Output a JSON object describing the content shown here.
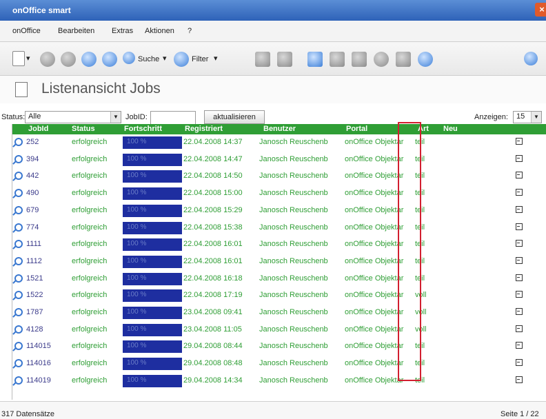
{
  "window": {
    "title": "onOffice smart",
    "close_label": "×"
  },
  "menu": [
    "onOffice",
    "Bearbeiten",
    "Extras",
    "Aktionen",
    "?"
  ],
  "toolbar": {
    "search_label": "Suche",
    "filter_label": "Filter",
    "dropdown_arrow": "▾"
  },
  "page_title": "Listenansicht Jobs",
  "filters": {
    "status_label": "Status:",
    "status_value": "Alle",
    "jobid_label": "JobID:",
    "jobid_value": "",
    "refresh_button": "aktualisieren",
    "show_label": "Anzeigen:",
    "show_value": "15"
  },
  "table": {
    "columns": [
      "JobId",
      "Status",
      "Fortschritt",
      "Registriert",
      "Benutzer",
      "Portal",
      "Art",
      "Neu"
    ],
    "rows": [
      {
        "id": "252",
        "status": "erfolgreich",
        "progress": "100 %",
        "registered": "22.04.2008 14:37",
        "user": "Janosch Reuschenb",
        "portal": "onOffice Objektar",
        "art": "teil"
      },
      {
        "id": "394",
        "status": "erfolgreich",
        "progress": "100 %",
        "registered": "22.04.2008 14:47",
        "user": "Janosch Reuschenb",
        "portal": "onOffice Objektar",
        "art": "teil"
      },
      {
        "id": "442",
        "status": "erfolgreich",
        "progress": "100 %",
        "registered": "22.04.2008 14:50",
        "user": "Janosch Reuschenb",
        "portal": "onOffice Objektar",
        "art": "teil"
      },
      {
        "id": "490",
        "status": "erfolgreich",
        "progress": "100 %",
        "registered": "22.04.2008 15:00",
        "user": "Janosch Reuschenb",
        "portal": "onOffice Objektar",
        "art": "teil"
      },
      {
        "id": "679",
        "status": "erfolgreich",
        "progress": "100 %",
        "registered": "22.04.2008 15:29",
        "user": "Janosch Reuschenb",
        "portal": "onOffice Objektar",
        "art": "teil"
      },
      {
        "id": "774",
        "status": "erfolgreich",
        "progress": "100 %",
        "registered": "22.04.2008 15:38",
        "user": "Janosch Reuschenb",
        "portal": "onOffice Objektar",
        "art": "teil"
      },
      {
        "id": "1111",
        "status": "erfolgreich",
        "progress": "100 %",
        "registered": "22.04.2008 16:01",
        "user": "Janosch Reuschenb",
        "portal": "onOffice Objektar",
        "art": "teil"
      },
      {
        "id": "1112",
        "status": "erfolgreich",
        "progress": "100 %",
        "registered": "22.04.2008 16:01",
        "user": "Janosch Reuschenb",
        "portal": "onOffice Objektar",
        "art": "teil"
      },
      {
        "id": "1521",
        "status": "erfolgreich",
        "progress": "100 %",
        "registered": "22.04.2008 16:18",
        "user": "Janosch Reuschenb",
        "portal": "onOffice Objektar",
        "art": "teil"
      },
      {
        "id": "1522",
        "status": "erfolgreich",
        "progress": "100 %",
        "registered": "22.04.2008 17:19",
        "user": "Janosch Reuschenb",
        "portal": "onOffice Objektar",
        "art": "voll"
      },
      {
        "id": "1787",
        "status": "erfolgreich",
        "progress": "100 %",
        "registered": "23.04.2008 09:41",
        "user": "Janosch Reuschenb",
        "portal": "onOffice Objektar",
        "art": "voll"
      },
      {
        "id": "4128",
        "status": "erfolgreich",
        "progress": "100 %",
        "registered": "23.04.2008 11:05",
        "user": "Janosch Reuschenb",
        "portal": "onOffice Objektar",
        "art": "voll"
      },
      {
        "id": "114015",
        "status": "erfolgreich",
        "progress": "100 %",
        "registered": "29.04.2008 08:44",
        "user": "Janosch Reuschenb",
        "portal": "onOffice Objektar",
        "art": "teil"
      },
      {
        "id": "114016",
        "status": "erfolgreich",
        "progress": "100 %",
        "registered": "29.04.2008 08:48",
        "user": "Janosch Reuschenb",
        "portal": "onOffice Objektar",
        "art": "teil"
      },
      {
        "id": "114019",
        "status": "erfolgreich",
        "progress": "100 %",
        "registered": "29.04.2008 14:34",
        "user": "Janosch Reuschenb",
        "portal": "onOffice Objektar",
        "art": "teil"
      }
    ]
  },
  "statusbar": {
    "records": "317 Datensätze",
    "page": "Seite 1 / 22"
  },
  "colors": {
    "header_green": "#2f9e35",
    "progress_blue": "#1e2ea0",
    "highlight_red": "#d21f2f",
    "titlebar_blue": "#2e62b8"
  },
  "icons": [
    "new-document-icon",
    "back-icon",
    "stop-icon",
    "forward-icon",
    "refresh-icon",
    "search-icon",
    "filter-icon",
    "print-icon",
    "tools-icon",
    "settings-icon",
    "users-icon",
    "mail-icon",
    "clock-icon",
    "tasks-icon",
    "globe-icon",
    "info-icon",
    "magnifier-icon",
    "edit-icon"
  ]
}
